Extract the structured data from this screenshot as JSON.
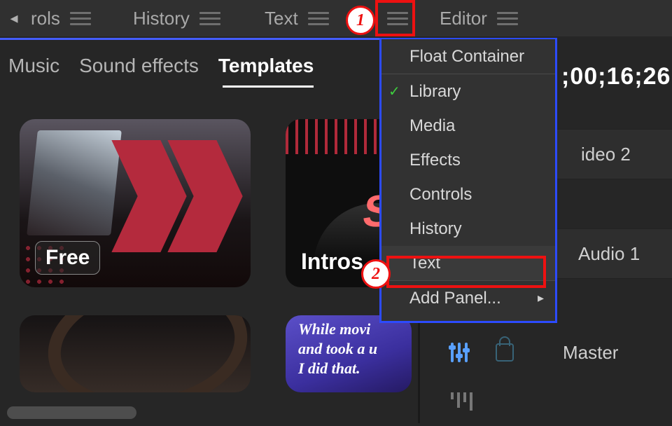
{
  "tabs": {
    "back_glyph": "◂",
    "rols": "rols",
    "history": "History",
    "text": "Text",
    "editor": "Editor"
  },
  "subtabs": {
    "music": "Music",
    "sfx": "Sound effects",
    "templates": "Templates"
  },
  "thumbs": {
    "free": "Free",
    "intros": "Intros",
    "sp": "SP",
    "quote_l1": "While movi",
    "quote_l2": "and took a u",
    "quote_l3": "I did that."
  },
  "menu": {
    "float": "Float Container",
    "library": "Library",
    "media": "Media",
    "effects": "Effects",
    "controls": "Controls",
    "history": "History",
    "text": "Text",
    "add_panel": "Add Panel...",
    "check": "✓",
    "arrow": "▸"
  },
  "timeline": {
    "timecode": ";00;16;26",
    "video2": "ideo 2",
    "audio1": "Audio 1",
    "master": "Master"
  },
  "annot": {
    "one": "1",
    "two": "2"
  }
}
